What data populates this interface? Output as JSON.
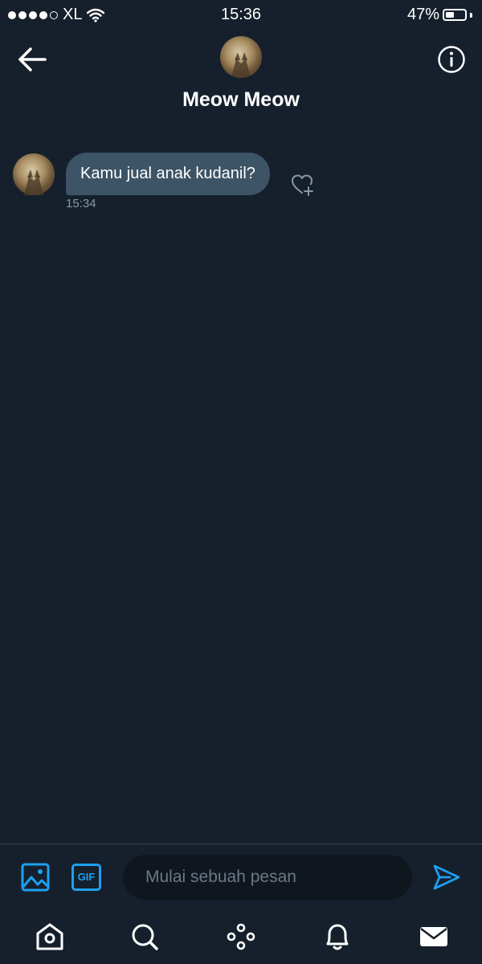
{
  "status_bar": {
    "carrier": "XL",
    "time": "15:36",
    "battery_percent": "47%",
    "battery_level": 0.47,
    "signal_bars": 4,
    "signal_max": 5,
    "icons": [
      "signal-dots-icon",
      "wifi-icon",
      "battery-icon"
    ]
  },
  "header": {
    "contact_name": "Meow Meow",
    "icons": [
      "back-arrow-icon",
      "info-icon"
    ]
  },
  "conversation": {
    "messages": [
      {
        "direction": "incoming",
        "text": "Kamu jual anak kudanil?",
        "time": "15:34",
        "action_icon": "heart-add-icon"
      }
    ]
  },
  "composer": {
    "placeholder": "Mulai sebuah pesan",
    "value": "",
    "gif_label": "GIF",
    "icons": [
      "image-icon",
      "gif-icon",
      "send-icon"
    ]
  },
  "tab_bar": {
    "tabs": [
      "home-icon",
      "search-icon",
      "explore-icon",
      "notifications-icon",
      "messages-icon"
    ],
    "active": "messages-icon"
  },
  "colors": {
    "background": "#16202c",
    "bubble": "#3d5466",
    "accent": "#1da1f2",
    "muted_text": "#8899a6"
  }
}
